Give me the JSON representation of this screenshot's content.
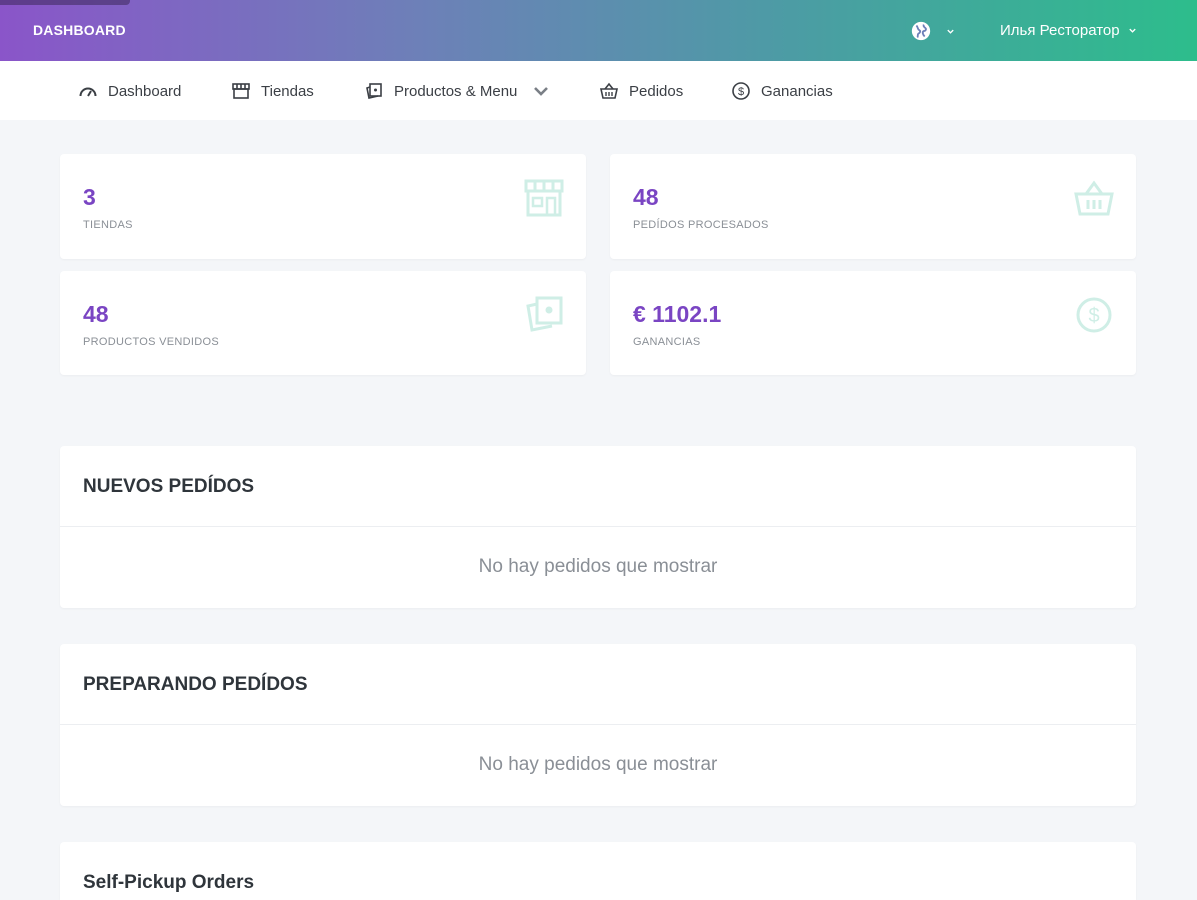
{
  "header": {
    "brand": "DASHBOARD",
    "user_name": "Илья Ресторатор",
    "language_icon": "globe-icon"
  },
  "nav": {
    "items": [
      {
        "label": "Dashboard",
        "icon": "speedometer-icon"
      },
      {
        "label": "Tiendas",
        "icon": "store-icon"
      },
      {
        "label": "Productos & Menu",
        "icon": "product-icon",
        "has_dropdown": true
      },
      {
        "label": "Pedidos",
        "icon": "basket-icon"
      },
      {
        "label": "Ganancias",
        "icon": "dollar-icon"
      }
    ]
  },
  "stats": [
    {
      "value": "3",
      "label": "TIENDAS",
      "icon": "store-icon"
    },
    {
      "value": "48",
      "label": "PEDÍDOS PROCESADOS",
      "icon": "basket-icon"
    },
    {
      "value": "48",
      "label": "PRODUCTOS VENDIDOS",
      "icon": "product-icon"
    },
    {
      "value": "€ 1102.1",
      "label": "GANANCIAS",
      "icon": "dollar-icon"
    }
  ],
  "sections": [
    {
      "title": "NUEVOS PEDÍDOS",
      "empty_text": "No hay pedidos que mostrar"
    },
    {
      "title": "PREPARANDO PEDÍDOS",
      "empty_text": "No hay pedidos que mostrar"
    },
    {
      "title": "Self-Pickup Orders"
    }
  ],
  "colors": {
    "accent": "#7a45c3",
    "gradient_start": "#8a55c9",
    "gradient_end": "#2dbd8c",
    "stat_icon": "#cfeee6"
  }
}
